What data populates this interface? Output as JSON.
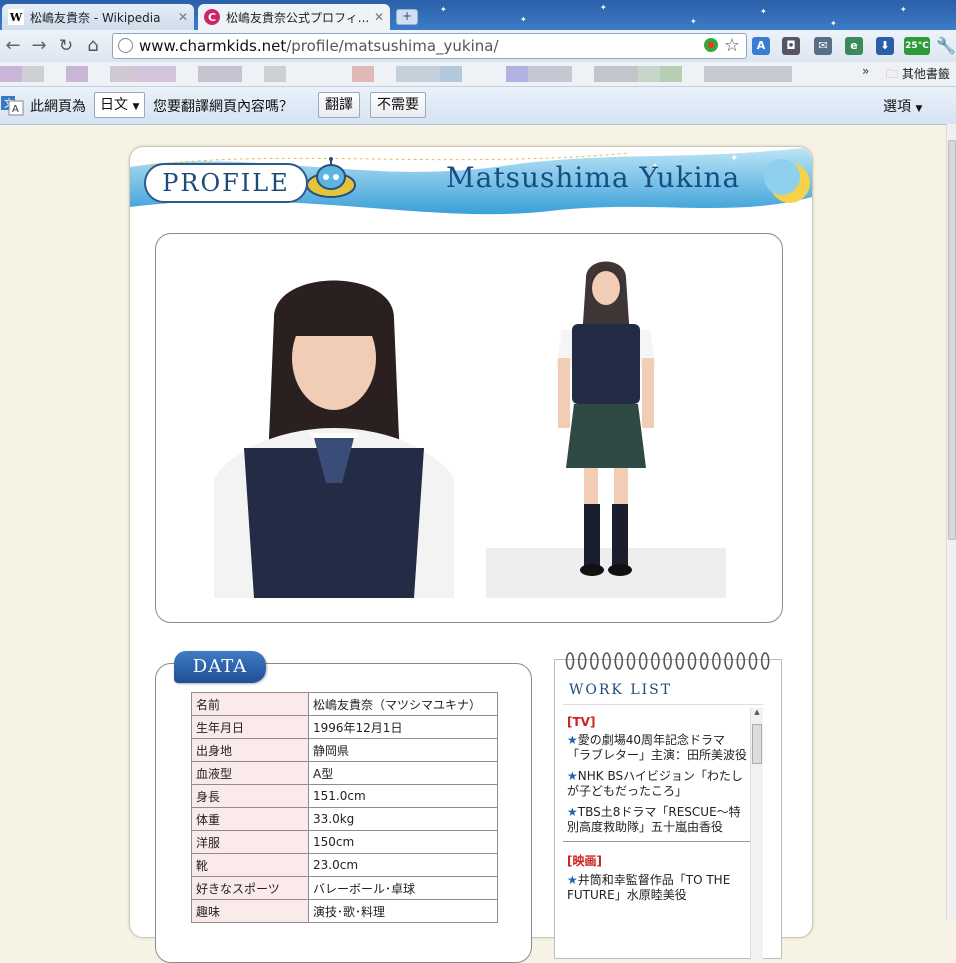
{
  "browser": {
    "tabs": [
      {
        "label": "松嶋友貴奈 - Wikipedia",
        "icon": "W"
      },
      {
        "label": "松嶋友貴奈公式プロフィ...",
        "icon": "C"
      }
    ],
    "url_host": "www.charmkids.net",
    "url_path": "/profile/matsushima_yukina/",
    "extension_badge": "25°C",
    "other_bookmarks": "其他書籤"
  },
  "translate_bar": {
    "prefix": "此網頁為",
    "language": "日文",
    "question": "您要翻譯網頁內容嗎？",
    "translate_button": "翻譯",
    "no_button": "不需要",
    "options": "選項"
  },
  "page": {
    "profile_label": "PROFILE",
    "name_en": "Matsushima Yukina",
    "data_label": "DATA",
    "data_rows": [
      {
        "key": "名前",
        "value": "松嶋友貴奈（マツシマユキナ）"
      },
      {
        "key": "生年月日",
        "value": "1996年12月1日"
      },
      {
        "key": "出身地",
        "value": "静岡県"
      },
      {
        "key": "血液型",
        "value": "A型"
      },
      {
        "key": "身長",
        "value": "151.0cm"
      },
      {
        "key": "体重",
        "value": "33.0kg"
      },
      {
        "key": "洋服",
        "value": "150cm"
      },
      {
        "key": "靴",
        "value": "23.0cm"
      },
      {
        "key": "好きなスポーツ",
        "value": "バレーボール･卓球"
      },
      {
        "key": "趣味",
        "value": "演技･歌･料理"
      }
    ],
    "worklist_title": "WORK LIST",
    "worklist": {
      "cat_tv": "[TV]",
      "tv_items": [
        "愛の劇場40周年記念ドラマ「ラブレター」主演：田所美波役",
        "NHK BSハイビジョン「わたしが子どもだったころ」",
        "TBS土8ドラマ「RESCUE～特別高度救助隊」五十嵐由香役"
      ],
      "cat_movie": "[映画]",
      "movie_items": [
        "井筒和幸監督作品「TO THE FUTURE」水原睦美役"
      ]
    }
  },
  "colors": {
    "accent": "#1d4b7c",
    "tab_bg": "#2a5fa8",
    "page_bg": "#f7f3e4"
  }
}
